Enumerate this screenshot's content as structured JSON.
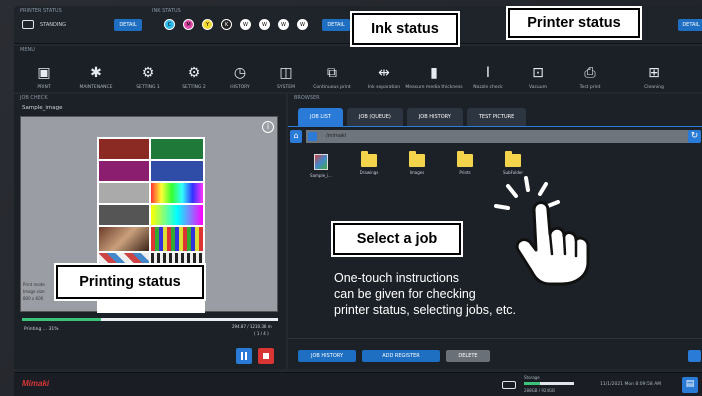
{
  "topbar": {
    "printer_label": "PRINTER STATUS",
    "printer_value": "STANDING",
    "printer_btn": "DETAIL",
    "ink_label": "INK STATUS",
    "ink_letters": [
      "C",
      "M",
      "Y",
      "K",
      "W",
      "W",
      "W",
      "W"
    ],
    "ink_btn": "DETAIL",
    "right_btn": "DETAIL"
  },
  "menu_label": "MENU",
  "menu_items": [
    {
      "icon": "▣",
      "label": "PRINT"
    },
    {
      "icon": "✱",
      "label": "MAINTENANCE"
    },
    {
      "icon": "⚙",
      "label": "SETTING 1"
    },
    {
      "icon": "⚙",
      "label": "SETTING 2"
    },
    {
      "icon": "◷",
      "label": "HISTORY"
    },
    {
      "icon": "◫",
      "label": "SYSTEM"
    },
    {
      "icon": "⧉",
      "label": "Continuous print"
    },
    {
      "icon": "⇹",
      "label": "Ink separation"
    },
    {
      "icon": "▮",
      "label": "Measure media thickness"
    },
    {
      "icon": "Ⅰ",
      "label": "Nozzle check"
    },
    {
      "icon": "⊡",
      "label": "Vacuum"
    },
    {
      "icon": "⎙",
      "label": "Test print"
    },
    {
      "icon": "⊞",
      "label": "Cleaning"
    }
  ],
  "job_check_label": "JOB CHECK",
  "job_name": "Sample_image",
  "preview_info_1": "Print mode",
  "preview_info_2": "Image size",
  "preview_info_3": "800 x 600",
  "progress_status": "Printing ... 31%",
  "progress_fraction": 0.31,
  "progress_right_1": "294.87 / 1210.36 m",
  "progress_right_2": "( 1 / 4 )",
  "browser_label": "BROWSER",
  "tabs": [
    "JOB LIST",
    "JOB (QUEUE)",
    "JOB HISTORY",
    "TEST PICTURE"
  ],
  "path": "/mimaki",
  "files": [
    {
      "name": "Sample_i...",
      "type": "image"
    },
    {
      "name": "Drawings",
      "type": "folder"
    },
    {
      "name": "Images",
      "type": "folder"
    },
    {
      "name": "Prints",
      "type": "folder"
    },
    {
      "name": "SubFolder",
      "type": "folder"
    }
  ],
  "browser_buttons": [
    "JOB HISTORY",
    "ADD REGISTER",
    "DELETE"
  ],
  "brand": "Mimaki",
  "storage_label": "Storage",
  "storage_value": "288GB / 924GB",
  "storage_fraction": 0.31,
  "datetime": "11/1/2021 Mon 8:09:58 AM",
  "callouts": {
    "ink": "Ink status",
    "printer": "Printer status",
    "job": "Select a job",
    "printing": "Printing status"
  },
  "instructions": [
    "One-touch instructions",
    "can be given for checking",
    "printer status, selecting jobs, etc."
  ],
  "colors": {
    "accent": "#1e6fc2",
    "pause": "#2a7bd8",
    "stop": "#d93535",
    "progress": "#3cc37a"
  }
}
